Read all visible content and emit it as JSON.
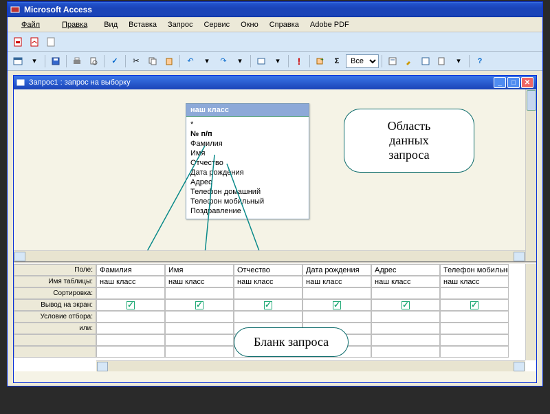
{
  "app": {
    "title": "Microsoft Access"
  },
  "menu": [
    "Файл",
    "Правка",
    "Вид",
    "Вставка",
    "Запрос",
    "Сервис",
    "Окно",
    "Справка",
    "Adobe PDF"
  ],
  "toolbar2_combo": "Все",
  "child": {
    "title": "Запрос1 : запрос на выборку",
    "table_name": "наш класс",
    "fields": [
      "*",
      "№ п/п",
      "Фамилия",
      "Имя",
      "Отчество",
      "Дата рождения",
      "Адрес",
      "Телефон домашний",
      "Телефон мобильный",
      "Поздравление"
    ]
  },
  "callouts": {
    "data_area": "Область\nданных\nзапроса",
    "query_form": "Бланк запроса"
  },
  "grid": {
    "row_labels": [
      "Поле:",
      "Имя таблицы:",
      "Сортировка:",
      "Вывод на экран:",
      "Условие отбора:",
      "или:"
    ],
    "columns": [
      {
        "field": "Фамилия",
        "table": "наш класс",
        "show": true
      },
      {
        "field": "Имя",
        "table": "наш класс",
        "show": true
      },
      {
        "field": "Отчество",
        "table": "наш класс",
        "show": true
      },
      {
        "field": "Дата рождения",
        "table": "наш класс",
        "show": true
      },
      {
        "field": "Адрес",
        "table": "наш класс",
        "show": true
      },
      {
        "field": "Телефон мобильны",
        "table": "наш класс",
        "show": true
      }
    ]
  }
}
